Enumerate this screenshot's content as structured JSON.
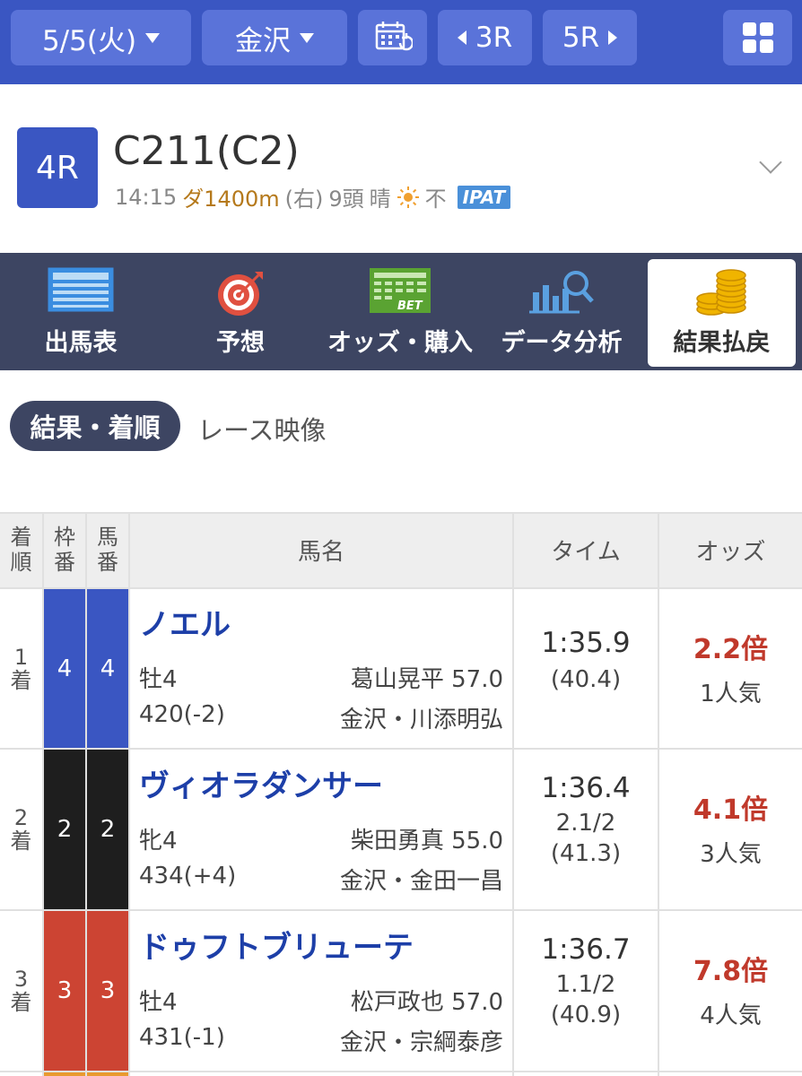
{
  "nav": {
    "date": "5/5(火)",
    "venue": "金沢",
    "prev_race": "3R",
    "next_race": "5R"
  },
  "race": {
    "number": "4R",
    "name": "C211(C2)",
    "time": "14:15",
    "distance": "ダ1400m",
    "direction": "(右)",
    "runners": "9頭",
    "weather": "晴",
    "track": "不",
    "ipat": "IPAT"
  },
  "tabs": [
    {
      "label": "出馬表",
      "icon": "entry-table-icon"
    },
    {
      "label": "予想",
      "icon": "target-icon"
    },
    {
      "label": "オッズ・購入",
      "icon": "bet-icon"
    },
    {
      "label": "データ分析",
      "icon": "data-analysis-icon"
    },
    {
      "label": "結果払戻",
      "icon": "coins-icon"
    }
  ],
  "subtabs": {
    "active": "結果・着順",
    "other": "レース映像"
  },
  "table": {
    "headers": {
      "rank": "着順",
      "frame": "枠番",
      "horse_no": "馬番",
      "name": "馬名",
      "time": "タイム",
      "odds": "オッズ"
    },
    "rows": [
      {
        "rank": "1",
        "rank_suffix": "着",
        "frame": "4",
        "horse_no": "4",
        "frame_color": "#3a56c2",
        "name": "ノエル",
        "sex_age": "牡4",
        "jockey_weight": "葛山晃平 57.0",
        "body_weight": "420(-2)",
        "trainer": "金沢・川添明弘",
        "time": "1:35.9",
        "margin": "",
        "last3f": "(40.4)",
        "odds": "2.2倍",
        "popularity": "1人気"
      },
      {
        "rank": "2",
        "rank_suffix": "着",
        "frame": "2",
        "horse_no": "2",
        "frame_color": "#1e1e1e",
        "name": "ヴィオラダンサー",
        "sex_age": "牝4",
        "jockey_weight": "柴田勇真 55.0",
        "body_weight": "434(+4)",
        "trainer": "金沢・金田一昌",
        "time": "1:36.4",
        "margin": "2.1/2",
        "last3f": "(41.3)",
        "odds": "4.1倍",
        "popularity": "3人気"
      },
      {
        "rank": "3",
        "rank_suffix": "着",
        "frame": "3",
        "horse_no": "3",
        "frame_color": "#cc4433",
        "name": "ドゥフトブリューテ",
        "sex_age": "牡4",
        "jockey_weight": "松戸政也 57.0",
        "body_weight": "431(-1)",
        "trainer": "金沢・宗綱泰彦",
        "time": "1:36.7",
        "margin": "1.1/2",
        "last3f": "(40.9)",
        "odds": "7.8倍",
        "popularity": "4人気"
      }
    ]
  }
}
